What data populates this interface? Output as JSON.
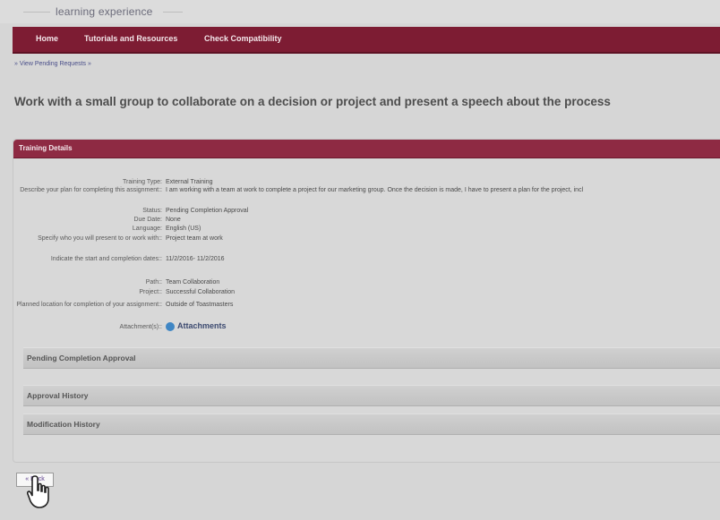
{
  "brand": {
    "tagline": "learning experience"
  },
  "nav": {
    "items": [
      {
        "label": "Home"
      },
      {
        "label": "Tutorials and Resources"
      },
      {
        "label": "Check Compatibility"
      }
    ]
  },
  "breadcrumb": "» View Pending Requests »",
  "page_title": "Work with a small group to collaborate on a decision or project and present a speech about the process",
  "panel": {
    "title": "Training Details",
    "fields": [
      {
        "label": "Training Type:",
        "value": "External Training"
      },
      {
        "label": "Describe your plan for completing this assignment::",
        "value": "I am working with a team at work to complete a project for our marketing group. Once the decision is made, I have to present a plan for the project, incl"
      },
      {
        "label": "Status:",
        "value": "Pending Completion Approval"
      },
      {
        "label": "Due Date:",
        "value": "None"
      },
      {
        "label": "Language:",
        "value": "English (US)"
      },
      {
        "label": "Specify who you will present to or work with::",
        "value": "Project team at work"
      },
      {
        "label": "Indicate the start and completion dates::",
        "value": "11/2/2016- 11/2/2016"
      },
      {
        "label": "Path::",
        "value": "Team Collaboration"
      },
      {
        "label": "Project::",
        "value": "Successful Collaboration"
      },
      {
        "label": "Planned location for completion of your assignment::",
        "value": "Outside of Toastmasters"
      },
      {
        "label": "Attachment(s)::",
        "value": "Attachments"
      }
    ]
  },
  "sections": [
    {
      "label": "Pending Completion Approval"
    },
    {
      "label": "Approval History"
    },
    {
      "label": "Modification History"
    }
  ],
  "back_button": "« Back",
  "colors": {
    "nav": "#7d1c33",
    "panel_header": "#8e2a43",
    "link": "#4a4f8a"
  }
}
